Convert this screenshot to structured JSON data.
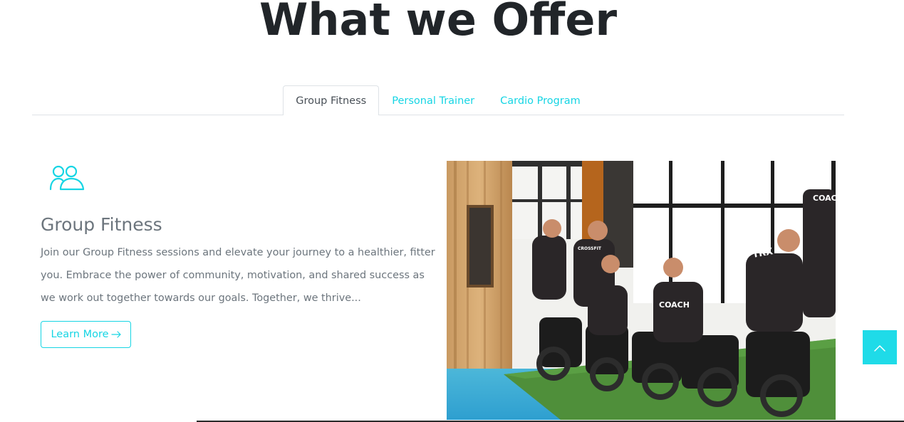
{
  "section": {
    "title": "What we Offer"
  },
  "tabs": [
    {
      "label": "Group Fitness",
      "active": true
    },
    {
      "label": "Personal Trainer",
      "active": false
    },
    {
      "label": "Cardio Program",
      "active": false
    }
  ],
  "feature": {
    "icon": "people-icon",
    "title": "Group Fitness",
    "description": "Join our Group Fitness sessions and elevate your journey to a healthier, fitter you. Embrace the power of community, motivation, and shared success as we work out together towards our goals. Together, we thrive...",
    "button_label": "Learn More",
    "button_icon": "arrow-right-icon"
  },
  "photo": {
    "shirt_texts": [
      "COACH",
      "TRX",
      "COACH",
      "CROSSFIT"
    ]
  },
  "back_to_top": {
    "icon": "chevron-up-icon"
  },
  "colors": {
    "accent": "#16d5e4",
    "heading": "#212529",
    "muted": "#6c757d"
  }
}
